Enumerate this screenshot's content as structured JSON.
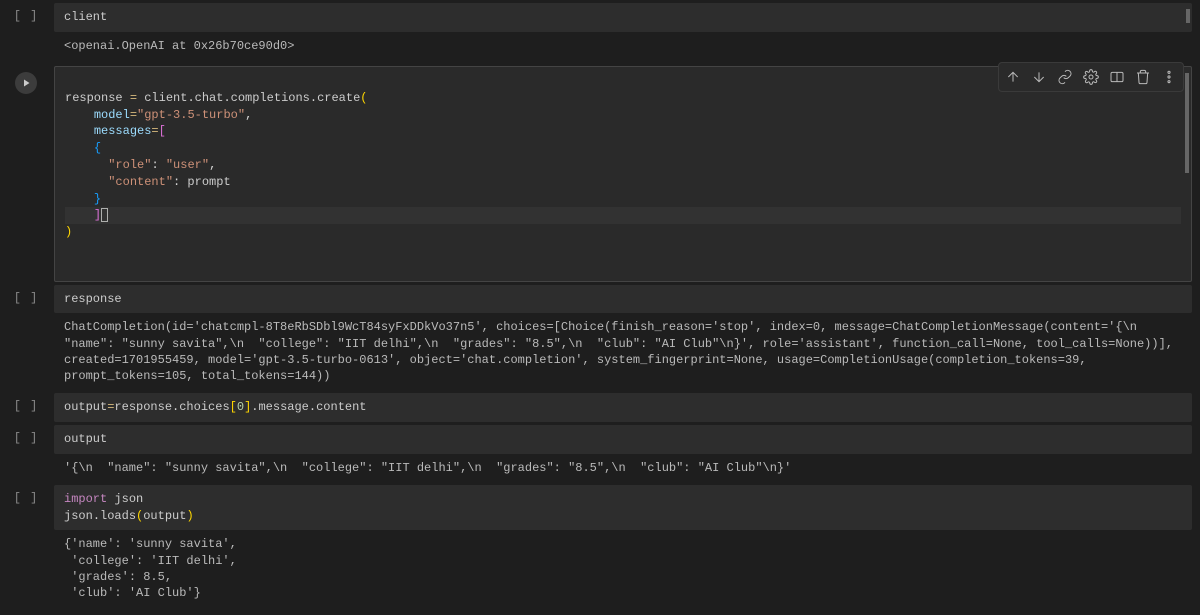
{
  "cells": {
    "c0": {
      "prompt": "[ ]",
      "code_html": "<span class='plain'>client</span>",
      "output": "<openai.OpenAI at 0x26b70ce90d0>"
    },
    "c1": {
      "code_lines": [
        "response = client.chat.completions.create(",
        "    model=\"gpt-3.5-turbo\",",
        "    messages=[",
        "    {",
        "      \"role\": \"user\",",
        "      \"content\": prompt",
        "    }",
        "    ]",
        ")"
      ]
    },
    "c2": {
      "prompt": "[ ]",
      "code": "response",
      "output": "ChatCompletion(id='chatcmpl-8T8eRbSDbl9WcT84syFxDDkVo37n5', choices=[Choice(finish_reason='stop', index=0, message=ChatCompletionMessage(content='{\\n  \"name\": \"sunny savita\",\\n  \"college\": \"IIT delhi\",\\n  \"grades\": \"8.5\",\\n  \"club\": \"AI Club\"\\n}', role='assistant', function_call=None, tool_calls=None))], created=1701955459, model='gpt-3.5-turbo-0613', object='chat.completion', system_fingerprint=None, usage=CompletionUsage(completion_tokens=39, prompt_tokens=105, total_tokens=144))"
    },
    "c3": {
      "prompt": "[ ]",
      "code": "output=response.choices[0].message.content"
    },
    "c4": {
      "prompt": "[ ]",
      "code": "output",
      "output": "'{\\n  \"name\": \"sunny savita\",\\n  \"college\": \"IIT delhi\",\\n  \"grades\": \"8.5\",\\n  \"club\": \"AI Club\"\\n}'"
    },
    "c5": {
      "prompt": "[ ]",
      "code_l1": "import json",
      "code_l2": "json.loads(output)",
      "output": "{'name': 'sunny savita',\n 'college': 'IIT delhi',\n 'grades': 8.5,\n 'club': 'AI Club'}"
    }
  },
  "toolbar": {
    "up": "Move cell up",
    "down": "Move cell down",
    "link": "Copy link",
    "settings": "Settings",
    "mirror": "Mirror cell",
    "delete": "Delete cell",
    "more": "More actions"
  }
}
